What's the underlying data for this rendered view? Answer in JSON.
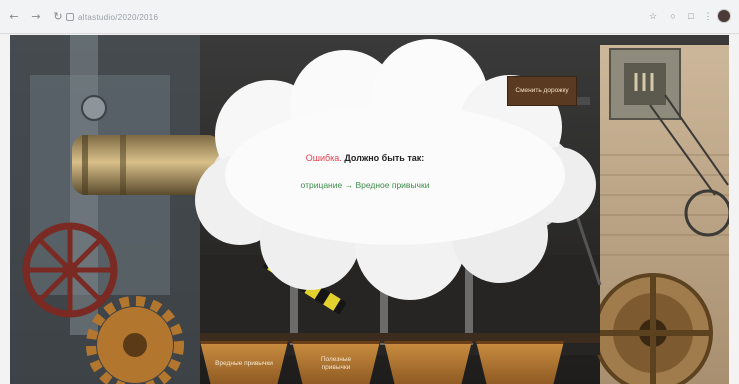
{
  "browser": {
    "url": "altastudio/2020/2016",
    "back_icon": "back-arrow-icon",
    "forward_icon": "forward-arrow-icon",
    "reload_icon": "reload-icon",
    "lock_icon": "lock-icon"
  },
  "game": {
    "sign_label": "Сменить дорожку",
    "feedback": {
      "error_word": "Ошибка.",
      "message": "Должно быть так:",
      "correct_answer": "отрицание → Вредное привычки"
    },
    "hoppers": [
      {
        "label": "Вредные привычки"
      },
      {
        "label": "Полезные привычки"
      },
      {
        "label": ""
      },
      {
        "label": ""
      }
    ]
  },
  "colors": {
    "error": "#e8414d",
    "correct": "#3f8c4c"
  }
}
